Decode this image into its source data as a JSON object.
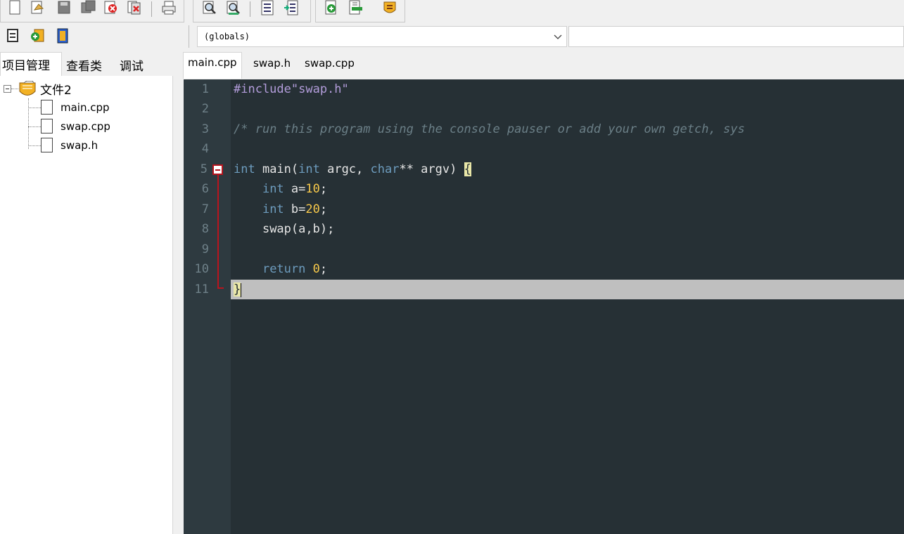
{
  "toolbar": {
    "row1_icons": [
      "new-file-icon",
      "open-folder-icon",
      "save-icon",
      "save-all-icon",
      "close-icon",
      "close-all-icon",
      "print-icon",
      "find-icon",
      "replace-icon",
      "toggle-bookmark-icon",
      "goto-icon",
      "add-file-icon",
      "remove-file-icon",
      "project-options-icon"
    ],
    "row2_icons": [
      "new-project-icon",
      "add-to-project-icon",
      "project-properties-icon"
    ]
  },
  "scope_combo": {
    "value": "(globals)"
  },
  "symbol_combo": {
    "value": ""
  },
  "left_tabs": [
    {
      "label": "项目管理",
      "active": true
    },
    {
      "label": "查看类",
      "active": false
    },
    {
      "label": "调试",
      "active": false
    }
  ],
  "project_tree": {
    "root": "文件2",
    "files": [
      "main.cpp",
      "swap.cpp",
      "swap.h"
    ]
  },
  "editor_tabs": [
    {
      "label": "main.cpp",
      "active": true
    },
    {
      "label": "swap.h",
      "active": false
    },
    {
      "label": "swap.cpp",
      "active": false
    }
  ],
  "code": {
    "line_numbers": [
      "1",
      "2",
      "3",
      "4",
      "5",
      "6",
      "7",
      "8",
      "9",
      "10",
      "11"
    ],
    "line1": {
      "pp": "#include\"swap.h\""
    },
    "line3": {
      "comment": "/* run this program using the console pauser or add your own getch, sys"
    },
    "line5": {
      "kw1": "int",
      "t1": " main(",
      "kw2": "int",
      "t2": " argc, ",
      "kw3": "char",
      "t3": "** argv) ",
      "brace": "{"
    },
    "line6": {
      "indent": "    ",
      "kw": "int",
      "t": " a=",
      "num": "10",
      "end": ";"
    },
    "line7": {
      "indent": "    ",
      "kw": "int",
      "t": " b=",
      "num": "20",
      "end": ";"
    },
    "line8": {
      "indent": "    ",
      "t": "swap(a,b);"
    },
    "line10": {
      "indent": "    ",
      "kw": "return",
      "sp": " ",
      "num": "0",
      "end": ";"
    },
    "line11": {
      "brace": "}"
    }
  },
  "colors": {
    "editor_bg": "#263035",
    "gutter_bg": "#2e3a40",
    "keyword": "#6d9cbe",
    "preprocessor": "#b39ddb",
    "comment": "#6b7f87",
    "number": "#f6c84a",
    "fold_marker": "#b8141e",
    "current_line": "#bfbfbf"
  }
}
